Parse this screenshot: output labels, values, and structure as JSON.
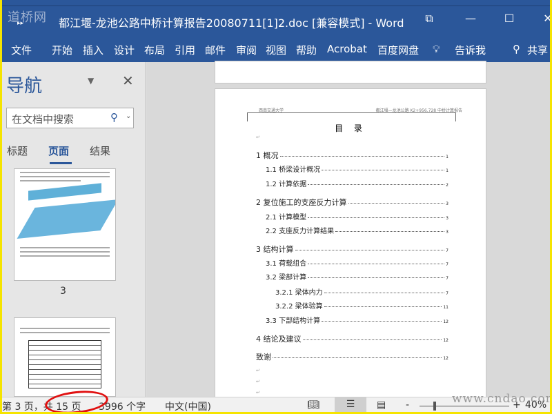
{
  "window": {
    "logo": "道桥网",
    "title": "都江堰-龙池公路中桥计算报告20080711[1]2.doc [兼容模式]  -  Word",
    "restore_icon": "⧉",
    "minimize": "—",
    "maximize": "☐",
    "close": "✕"
  },
  "ribbon": {
    "tabs": [
      "文件",
      "开始",
      "插入",
      "设计",
      "布局",
      "引用",
      "邮件",
      "审阅",
      "视图",
      "帮助",
      "Acrobat",
      "百度网盘"
    ],
    "tell_me": "告诉我",
    "share": "共享"
  },
  "nav": {
    "title": "导航",
    "search_placeholder": "在文档中搜索",
    "tabs": [
      "标题",
      "页面",
      "结果"
    ],
    "active_tab": "页面",
    "thumb_page_label": "3"
  },
  "document": {
    "header_left": "西南交通大学",
    "header_right": "都江堰—龙池公路 K2+956.728 中桥计算报告",
    "toc_title": "目 录",
    "toc": [
      {
        "level": 1,
        "text": "1  概况",
        "page": "1"
      },
      {
        "level": 2,
        "text": "1.1  桥梁设计概况",
        "page": "1"
      },
      {
        "level": 2,
        "text": "1.2  计算依据",
        "page": "2"
      },
      {
        "level": 1,
        "text": "2  复位施工的支座反力计算",
        "page": "3"
      },
      {
        "level": 2,
        "text": "2.1  计算模型",
        "page": "3"
      },
      {
        "level": 2,
        "text": "2.2  支座反力计算结果",
        "page": "3"
      },
      {
        "level": 1,
        "text": "3  结构计算",
        "page": "7"
      },
      {
        "level": 2,
        "text": "3.1  荷载组合",
        "page": "7"
      },
      {
        "level": 2,
        "text": "3.2  梁部计算",
        "page": "7"
      },
      {
        "level": 3,
        "text": "3.2.1  梁体内力",
        "page": "7"
      },
      {
        "level": 3,
        "text": "3.2.2  梁体验算",
        "page": "11"
      },
      {
        "level": 2,
        "text": "3.3  下部结构计算",
        "page": "12"
      },
      {
        "level": 1,
        "text": "4  结论及建议",
        "page": "12"
      },
      {
        "level": 1,
        "text": "致谢",
        "page": "12"
      }
    ]
  },
  "status": {
    "page": "第 3 页，共 15 页",
    "words": "3996 个字",
    "language": "中文(中国)",
    "zoom_minus": "-",
    "zoom_plus": "+",
    "zoom": "40%",
    "watermark": "www.cndao.com"
  }
}
